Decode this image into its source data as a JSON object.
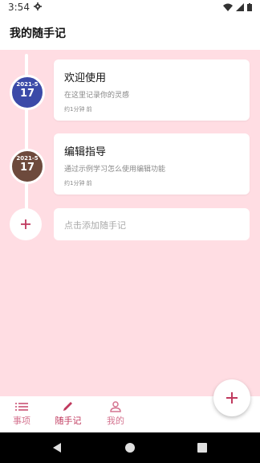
{
  "status_bar": {
    "time": "3:54"
  },
  "app_bar": {
    "title": "我的随手记"
  },
  "timeline": [
    {
      "year_month": "2021-5",
      "day": "17",
      "circle_color": "#3b4aa8",
      "title": "欢迎使用",
      "description": "在这里记录你的灵感",
      "time_ago": "约1分钟 前"
    },
    {
      "year_month": "2021-5",
      "day": "17",
      "circle_color": "#6d4a3c",
      "title": "编辑指导",
      "description": "通过示例学习怎么使用编辑功能",
      "time_ago": "约1分钟 前"
    }
  ],
  "add_entry": {
    "placeholder": "点击添加随手记"
  },
  "bottom_nav": [
    {
      "label": "事项",
      "icon": "list-icon"
    },
    {
      "label": "随手记",
      "icon": "pencil-icon",
      "active": true
    },
    {
      "label": "我的",
      "icon": "person-icon"
    }
  ],
  "colors": {
    "accent": "#c0395e",
    "background": "#ffdde3",
    "inactive": "#d47490"
  }
}
